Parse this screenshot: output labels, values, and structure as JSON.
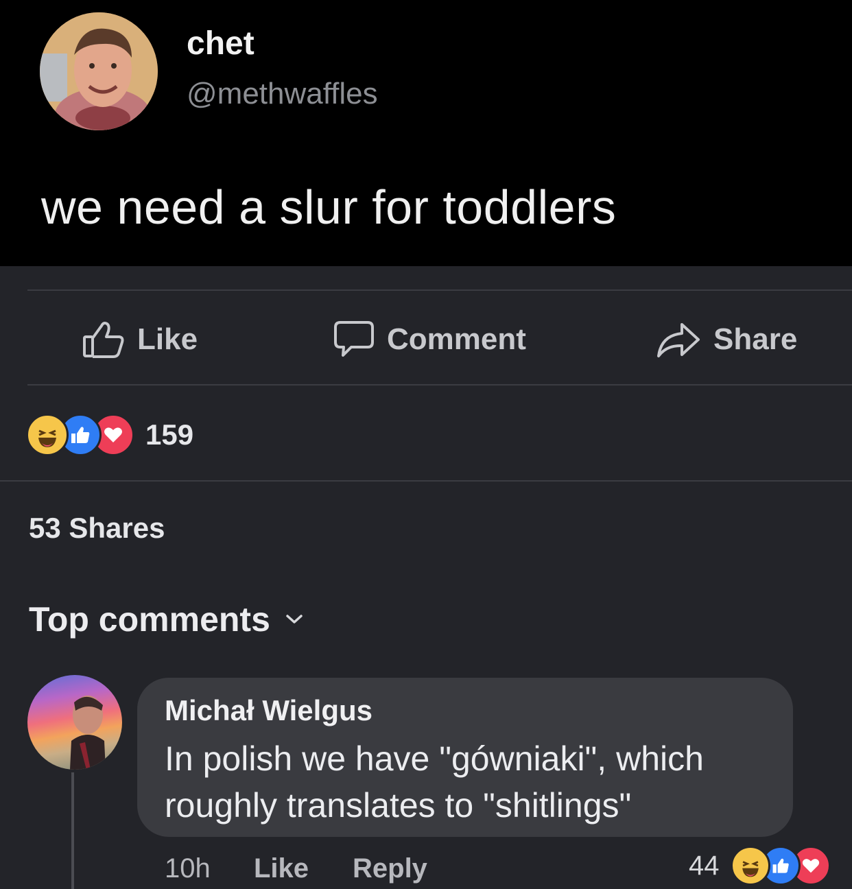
{
  "tweet": {
    "name": "chet",
    "handle": "@methwaffles",
    "text": "we need a slur for toddlers"
  },
  "actions": {
    "like_label": "Like",
    "comment_label": "Comment",
    "share_label": "Share"
  },
  "reactions": {
    "icons": [
      "haha-icon",
      "like-icon",
      "love-icon"
    ],
    "count": "159"
  },
  "shares_label": "53 Shares",
  "top_comments_label": "Top comments",
  "comment": {
    "author": "Michał Wielgus",
    "text": "In polish we have \"gówniaki\", which roughly translates to \"shitlings\"",
    "time": "10h",
    "like_label": "Like",
    "reply_label": "Reply",
    "reaction_count": "44",
    "reaction_icons": [
      "haha-icon",
      "like-icon",
      "love-icon"
    ]
  },
  "colors": {
    "page_bg": "#232429",
    "tweet_bg": "#000000",
    "bubble_bg": "#3a3b40",
    "haha": "#f6c64a",
    "like": "#2f7df5",
    "love": "#ee3e57"
  }
}
